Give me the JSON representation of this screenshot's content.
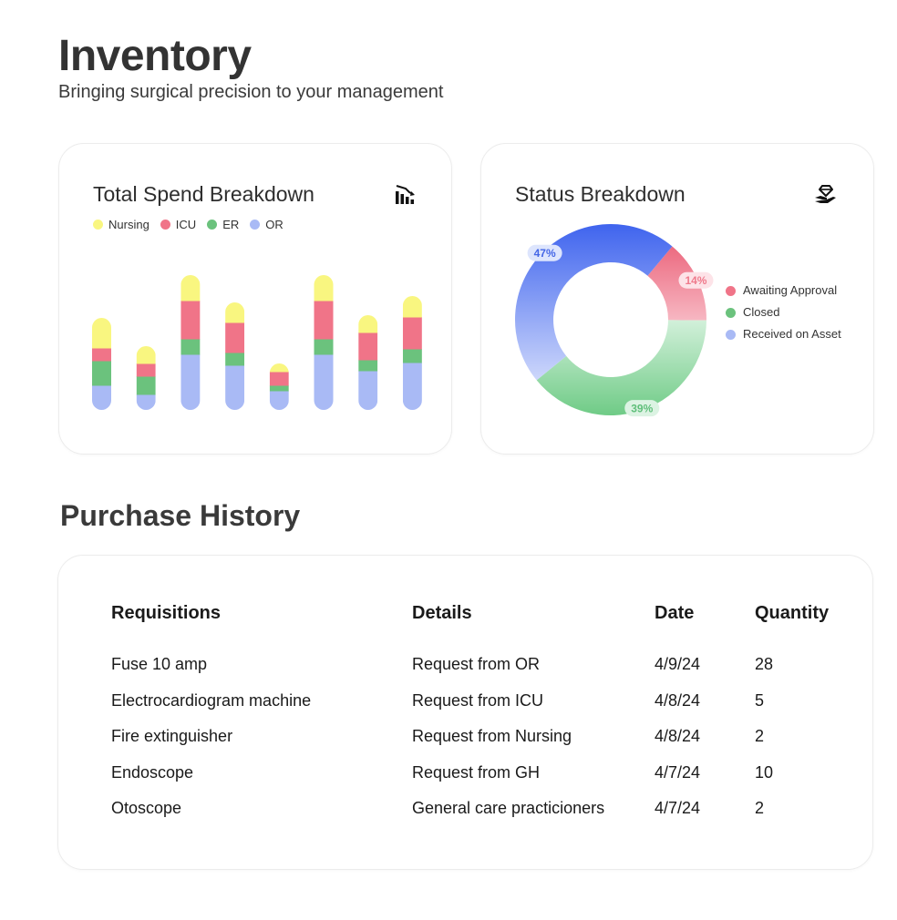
{
  "page": {
    "title": "Inventory",
    "subtitle": "Bringing surgical precision to your management"
  },
  "spend_card": {
    "title": "Total Spend Breakdown",
    "icon": "bar-chart-down-icon",
    "legend": [
      {
        "label": "Nursing",
        "color": "#f9f680"
      },
      {
        "label": "ICU",
        "color": "#f07488"
      },
      {
        "label": "ER",
        "color": "#6bc27d"
      },
      {
        "label": "OR",
        "color": "#a9baf5"
      }
    ]
  },
  "status_card": {
    "title": "Status Breakdown",
    "icon": "hand-diamond-icon",
    "legend": [
      {
        "label": "Awaiting Approval",
        "color": "#f07488"
      },
      {
        "label": "Closed",
        "color": "#6bc27d"
      },
      {
        "label": "Received on Asset",
        "color": "#a9baf5"
      }
    ]
  },
  "purchase_history": {
    "title": "Purchase History",
    "columns": [
      "Requisitions",
      "Details",
      "Date",
      "Quantity"
    ],
    "rows": [
      [
        "Fuse 10 amp",
        "Request from OR",
        "4/9/24",
        "28"
      ],
      [
        "Electrocardiogram machine",
        "Request from ICU",
        "4/8/24",
        "5"
      ],
      [
        "Fire extinguisher",
        "Request from Nursing",
        "4/8/24",
        "2"
      ],
      [
        "Endoscope",
        "Request from GH",
        "4/7/24",
        "10"
      ],
      [
        "Otoscope",
        "General care practicioners",
        "4/7/24",
        "2"
      ]
    ]
  },
  "chart_data": [
    {
      "type": "bar",
      "stacked": true,
      "title": "Total Spend Breakdown",
      "categories": [
        "",
        "",
        "",
        "",
        "",
        "",
        "",
        ""
      ],
      "ylim": [
        0,
        150
      ],
      "grid": false,
      "legend_position": "top-left",
      "series": [
        {
          "name": "OR",
          "color": "#a9baf5",
          "values": [
            27,
            17,
            61,
            49,
            21,
            61,
            43,
            52
          ]
        },
        {
          "name": "ER",
          "color": "#6bc27d",
          "values": [
            27,
            20,
            17,
            14,
            6,
            17,
            12,
            15
          ]
        },
        {
          "name": "ICU",
          "color": "#f07488",
          "values": [
            14,
            14,
            42,
            33,
            15,
            42,
            30,
            35
          ]
        },
        {
          "name": "Nursing",
          "color": "#f9f680",
          "values": [
            33,
            19,
            28,
            22,
            9,
            28,
            19,
            23
          ]
        }
      ]
    },
    {
      "type": "pie",
      "donut": true,
      "title": "Status Breakdown",
      "legend_position": "right",
      "slices": [
        {
          "label": "Awaiting Approval",
          "value": 14,
          "display": "14%",
          "color": "#f07488"
        },
        {
          "label": "Closed",
          "value": 39,
          "display": "39%",
          "color": "#6bc27d"
        },
        {
          "label": "Received on Asset",
          "value": 47,
          "display": "47%",
          "color": "#4a6ef0"
        }
      ]
    }
  ]
}
